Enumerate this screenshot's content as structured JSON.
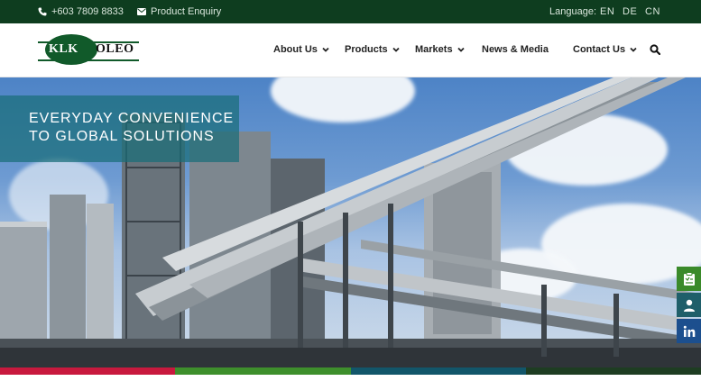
{
  "topbar": {
    "phone": "+603 7809 8833",
    "enquiry": "Product Enquiry",
    "language_label": "Language:",
    "languages": [
      "EN",
      "DE",
      "CN"
    ]
  },
  "logo": {
    "left": "KLK",
    "right": "OLEO"
  },
  "nav": {
    "items": [
      {
        "label": "About Us"
      },
      {
        "label": "Products"
      },
      {
        "label": "Markets"
      },
      {
        "label": "News & Media"
      },
      {
        "label": "Contact Us"
      }
    ]
  },
  "hero": {
    "caption_line1": "EVERYDAY CONVENIENCE",
    "caption_line2": "TO GLOBAL SOLUTIONS"
  },
  "side_buttons": [
    "clipboard-icon",
    "user-icon",
    "linkedin-icon"
  ],
  "colors": {
    "topbar": "#0e3d1f",
    "brand_green": "#115a2a",
    "strip": [
      "#c8193e",
      "#3e8f2c",
      "#12566a",
      "#1e3d22"
    ],
    "side_buttons": [
      "#3a8a2a",
      "#1f5f6a",
      "#1c4f8e"
    ]
  }
}
